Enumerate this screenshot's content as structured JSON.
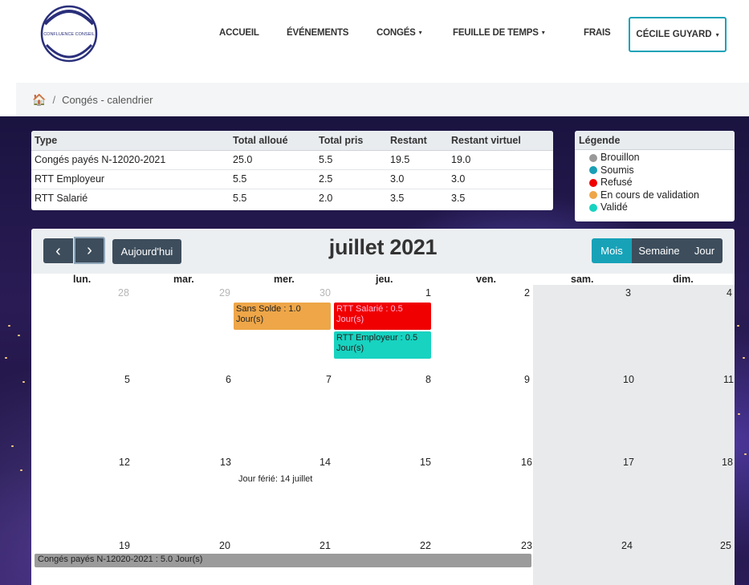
{
  "brand": {
    "logo_text": "CONFLUENCE CONSEIL"
  },
  "nav": {
    "items": [
      {
        "label": "ACCUEIL",
        "dropdown": false
      },
      {
        "label": "ÉVÉNEMENTS",
        "dropdown": false
      },
      {
        "label": "CONGÉS",
        "dropdown": true
      },
      {
        "label": "FEUILLE DE TEMPS",
        "dropdown": true
      },
      {
        "label": "FRAIS",
        "dropdown": false
      }
    ],
    "user": "CÉCILE GUYARD",
    "caret": "▾"
  },
  "breadcrumb": {
    "home_icon": "home-icon",
    "home_glyph": "🏠",
    "separator": "/",
    "current": "Congés - calendrier"
  },
  "balance": {
    "headers": [
      "Type",
      "Total alloué",
      "Total pris",
      "Restant",
      "Restant virtuel"
    ],
    "rows": [
      [
        "Congés payés N-12020-2021",
        "25.0",
        "5.5",
        "19.5",
        "19.0"
      ],
      [
        "RTT Employeur",
        "5.5",
        "2.5",
        "3.0",
        "3.0"
      ],
      [
        "RTT Salarié",
        "5.5",
        "2.0",
        "3.5",
        "3.5"
      ]
    ]
  },
  "legend": {
    "title": "Légende",
    "items": [
      {
        "label": "Brouillon",
        "color": "#999999"
      },
      {
        "label": "Soumis",
        "color": "#1a9fb6"
      },
      {
        "label": "Refusé",
        "color": "#f00000"
      },
      {
        "label": "En cours de validation",
        "color": "#eea648"
      },
      {
        "label": "Validé",
        "color": "#17d3c0"
      }
    ]
  },
  "calendar": {
    "title": "juillet 2021",
    "prev_icon": "chevron-left-icon",
    "prev_glyph": "‹",
    "next_icon": "chevron-right-icon",
    "next_glyph": "›",
    "today_label": "Aujourd'hui",
    "views": [
      "Mois",
      "Semaine",
      "Jour"
    ],
    "active_view": "Mois",
    "weekdays": [
      "lun.",
      "mar.",
      "mer.",
      "jeu.",
      "ven.",
      "sam.",
      "dim."
    ],
    "weeks": [
      [
        "28",
        "29",
        "30",
        "1",
        "2",
        "3",
        "4"
      ],
      [
        "5",
        "6",
        "7",
        "8",
        "9",
        "10",
        "11"
      ],
      [
        "12",
        "13",
        "14",
        "15",
        "16",
        "17",
        "18"
      ],
      [
        "19",
        "20",
        "21",
        "22",
        "23",
        "24",
        "25"
      ]
    ],
    "events": {
      "sans_solde": "Sans Solde : 1.0 Jour(s)",
      "rtt_salarie": "RTT Salarié : 0.5 Jour(s)",
      "rtt_employeur": "RTT Employeur : 0.5 Jour(s)",
      "holiday": "Jour férié: 14 juillet",
      "conges_payes": "Congés payés N-12020-2021 : 5.0 Jour(s)"
    }
  }
}
